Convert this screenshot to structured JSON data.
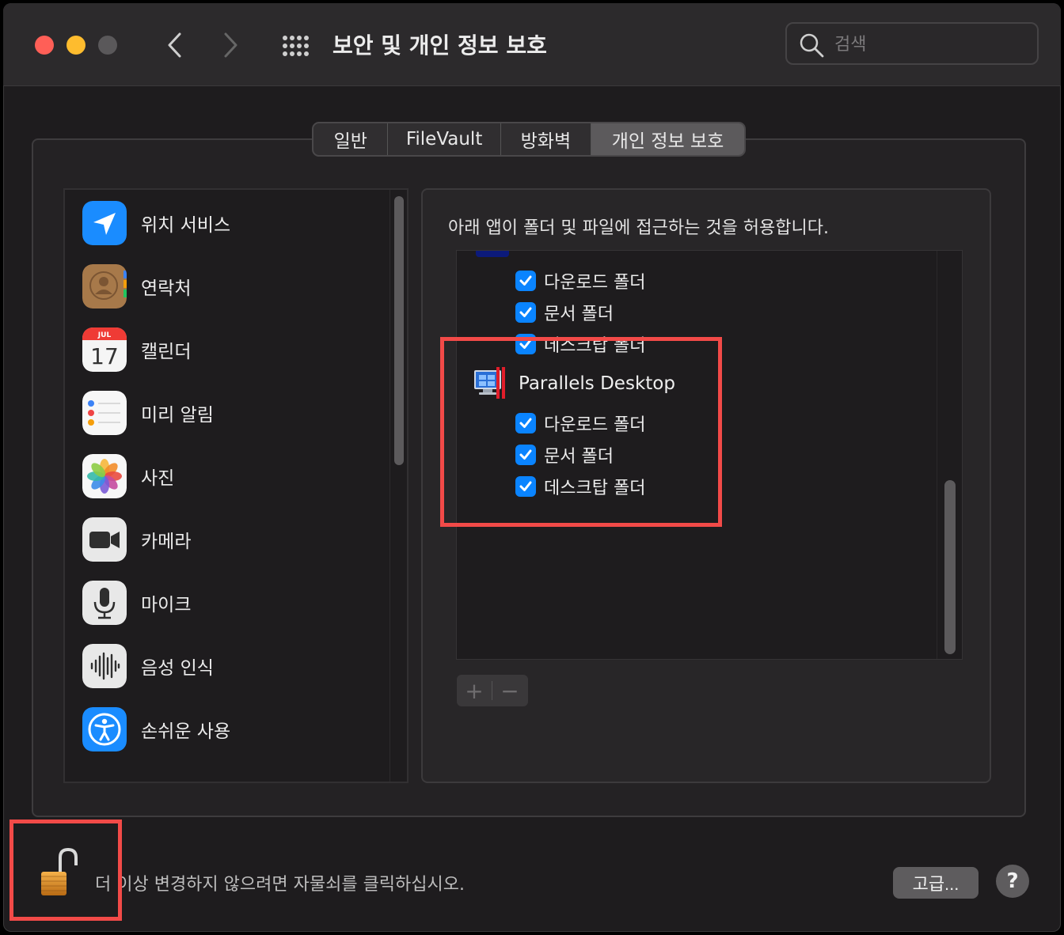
{
  "window": {
    "title": "보안 및 개인 정보 보호"
  },
  "search": {
    "placeholder": "검색"
  },
  "tabs": [
    {
      "label": "일반"
    },
    {
      "label": "FileVault"
    },
    {
      "label": "방화벽"
    },
    {
      "label": "개인 정보 보호",
      "selected": true
    }
  ],
  "sidebar": {
    "items": [
      {
        "label": "위치 서비스",
        "icon": "location-arrow-icon"
      },
      {
        "label": "연락처",
        "icon": "contacts-icon"
      },
      {
        "label": "캘린더",
        "icon": "calendar-icon",
        "icon_month": "JUL",
        "icon_day": "17"
      },
      {
        "label": "미리 알림",
        "icon": "reminders-icon"
      },
      {
        "label": "사진",
        "icon": "photos-icon"
      },
      {
        "label": "카메라",
        "icon": "camera-icon"
      },
      {
        "label": "마이크",
        "icon": "microphone-icon"
      },
      {
        "label": "음성 인식",
        "icon": "speech-waveform-icon"
      },
      {
        "label": "손쉬운 사용",
        "icon": "accessibility-icon"
      }
    ]
  },
  "detail": {
    "caption": "아래 앱이 폴더 및 파일에 접근하는 것을 허용합니다.",
    "previous_app_folders": [
      {
        "label": "다운로드 폴더",
        "checked": true
      },
      {
        "label": "문서 폴더",
        "checked": true
      },
      {
        "label": "데스크탑 폴더",
        "checked": true
      }
    ],
    "app": {
      "name": "Parallels Desktop",
      "icon": "parallels-desktop-icon",
      "folders": [
        {
          "label": "다운로드 폴더",
          "checked": true
        },
        {
          "label": "문서 폴더",
          "checked": true
        },
        {
          "label": "데스크탑 폴더",
          "checked": true
        }
      ]
    },
    "add_label": "+",
    "remove_label": "−"
  },
  "footer": {
    "lock_text": "더 이상 변경하지 않으려면 자물쇠를 클릭하십시오.",
    "advanced_label": "고급...",
    "help_label": "?"
  },
  "colors": {
    "accent": "#0a84ff",
    "highlight": "#f24a48"
  }
}
